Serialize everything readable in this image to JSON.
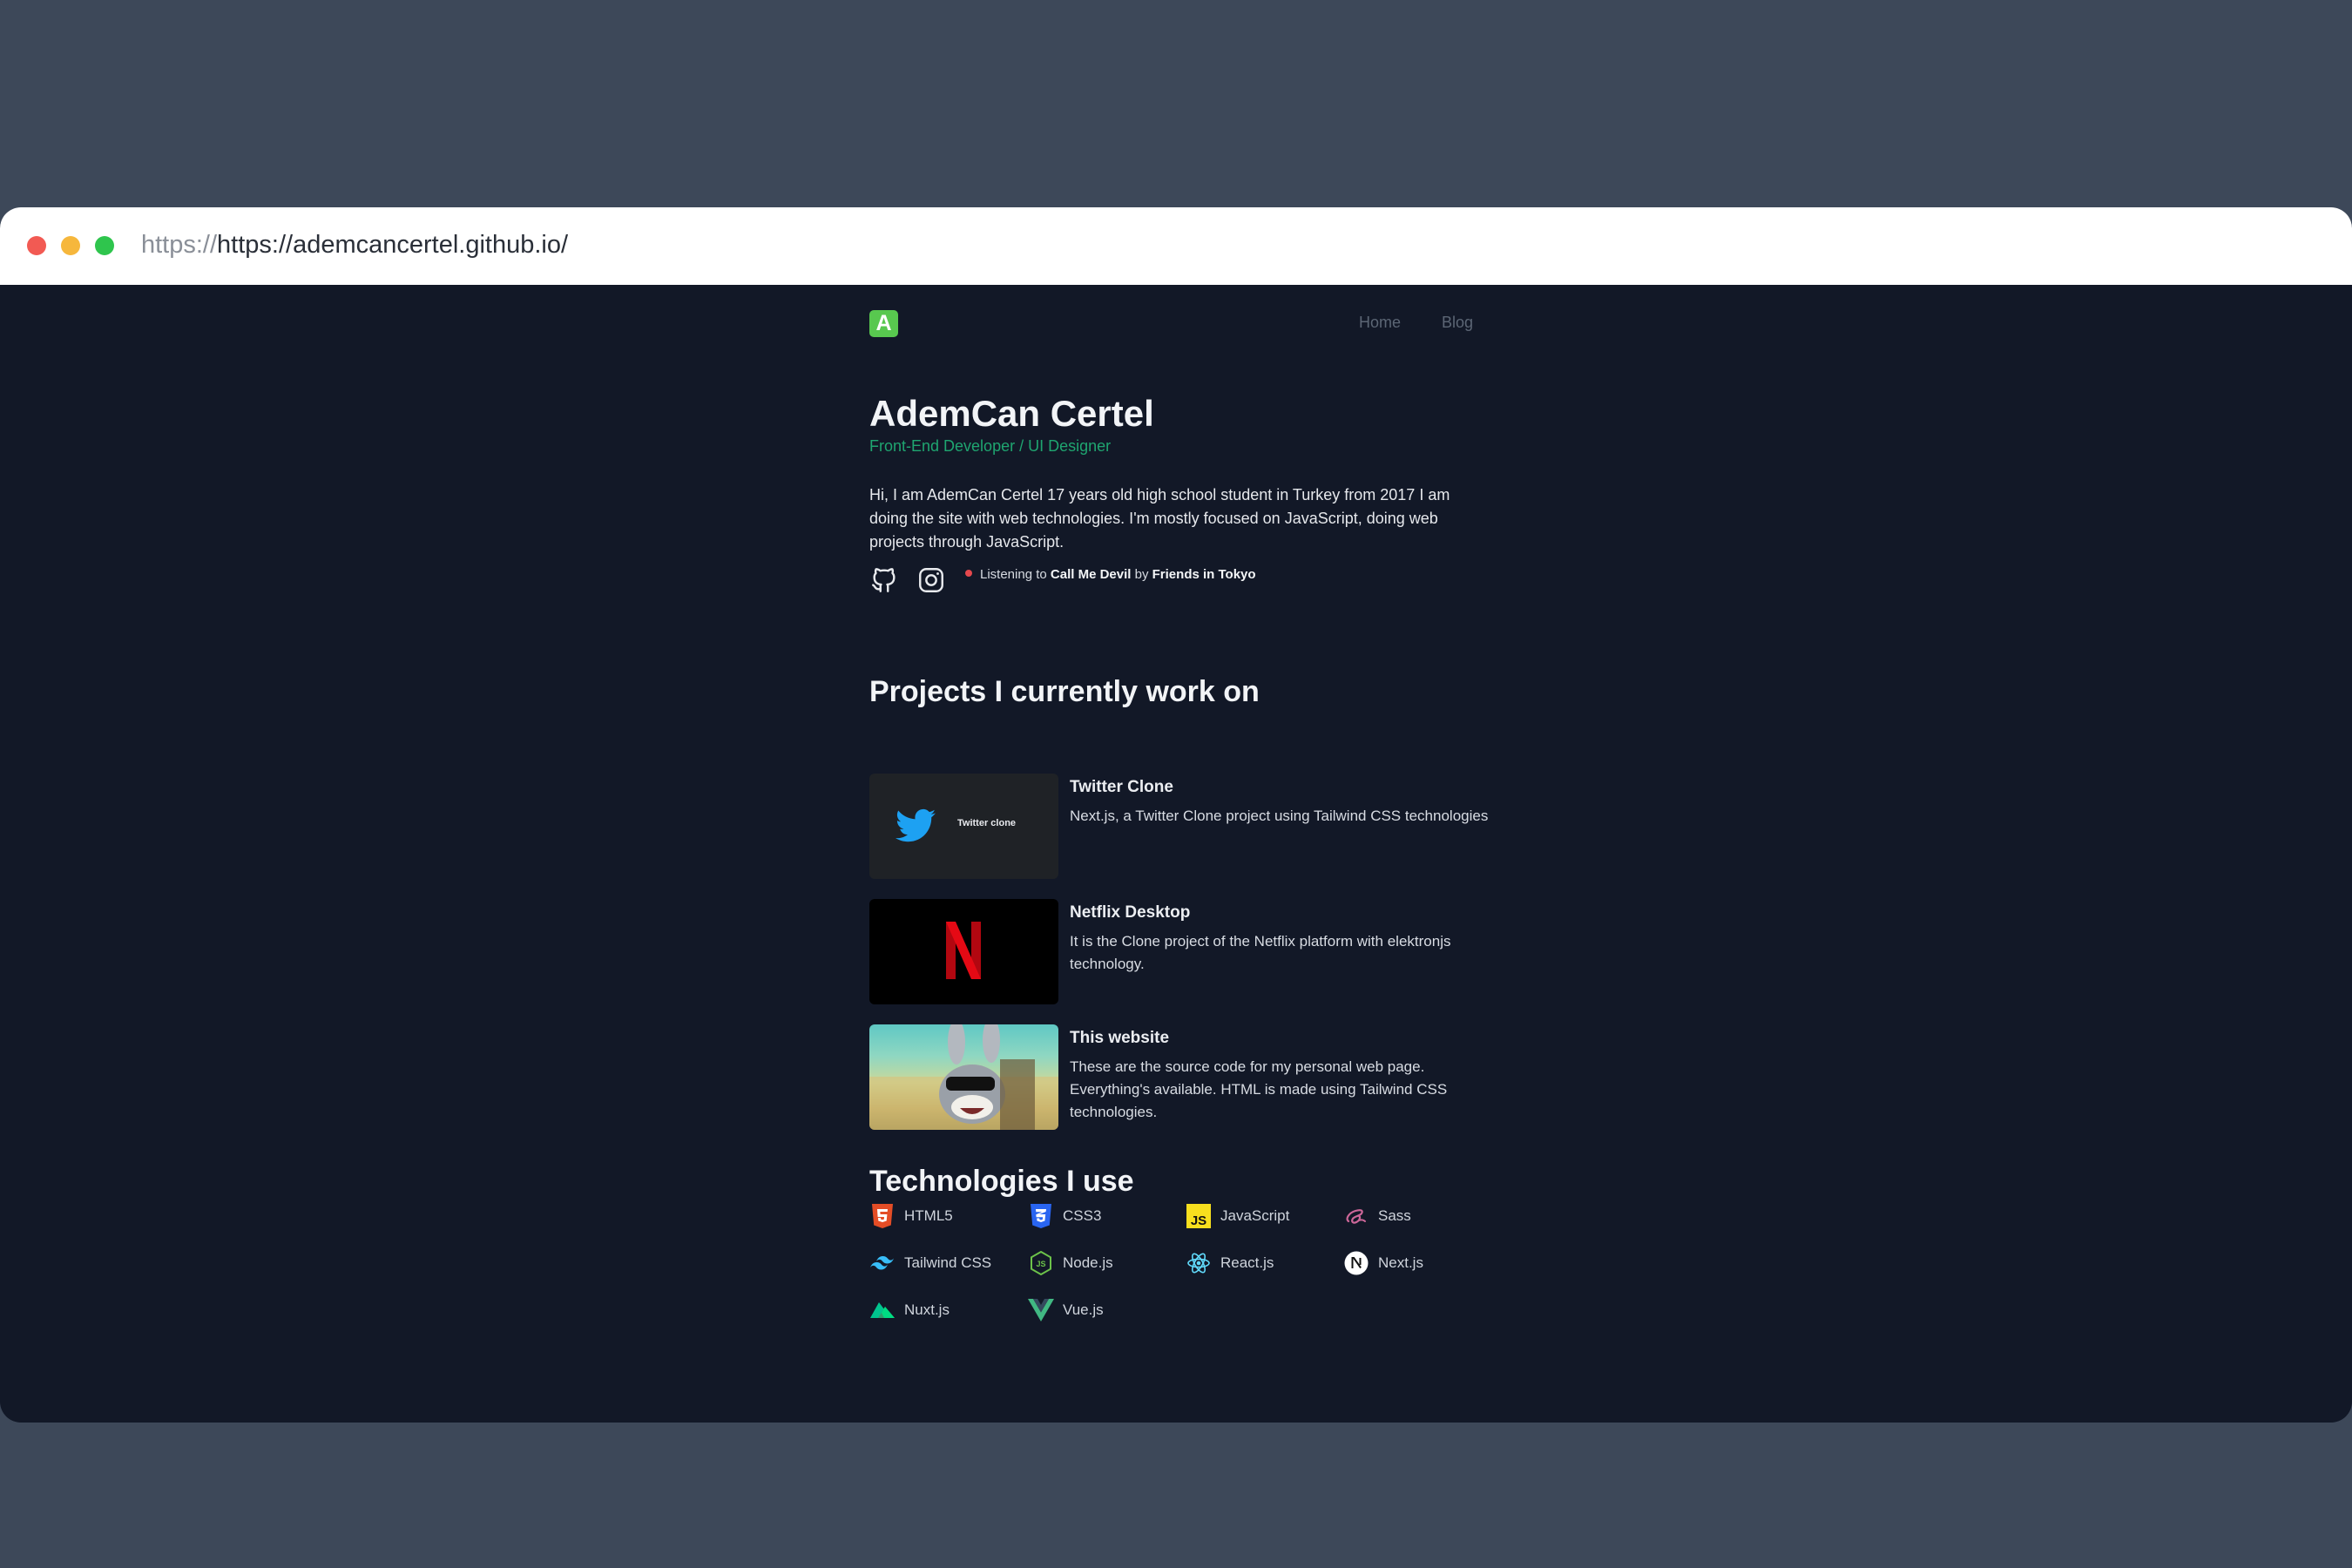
{
  "browser": {
    "url_prefix": "https://",
    "url": "https://ademcancertel.github.io/"
  },
  "header": {
    "logo_letter": "A",
    "nav": [
      "Home",
      "Blog"
    ]
  },
  "profile": {
    "name": "AdemCan Certel",
    "role": "Front-End Developer / UI Designer",
    "bio": "Hi, I am AdemCan Certel 17 years old high school student in Turkey from 2017 I am doing the site with web technologies. I'm mostly focused on JavaScript, doing web projects through JavaScript.",
    "listening_prefix": "Listening to",
    "song": "Call Me Devil",
    "by": "by",
    "artist": "Friends in Tokyo"
  },
  "projects": {
    "heading": "Projects I currently work on",
    "items": [
      {
        "title": "Twitter Clone",
        "description": "Next.js, a Twitter Clone project using Tailwind CSS technologies",
        "thumb_text": "Twitter clone"
      },
      {
        "title": "Netflix Desktop",
        "description": "It is the Clone project of the Netflix platform with elektronjs technology.",
        "thumb_text": "N"
      },
      {
        "title": "This website",
        "description": "These are the source code for my personal web page. Everything's available. HTML is made using Tailwind CSS technologies.",
        "thumb_text": ""
      }
    ]
  },
  "technologies": {
    "heading": "Technologies I use",
    "items": [
      {
        "label": "HTML5",
        "icon": "html5-icon"
      },
      {
        "label": "CSS3",
        "icon": "css3-icon"
      },
      {
        "label": "JavaScript",
        "icon": "javascript-icon"
      },
      {
        "label": "Sass",
        "icon": "sass-icon"
      },
      {
        "label": "Tailwind CSS",
        "icon": "tailwind-icon"
      },
      {
        "label": "Node.js",
        "icon": "nodejs-icon"
      },
      {
        "label": "React.js",
        "icon": "react-icon"
      },
      {
        "label": "Next.js",
        "icon": "nextjs-icon"
      },
      {
        "label": "Nuxt.js",
        "icon": "nuxtjs-icon"
      },
      {
        "label": "Vue.js",
        "icon": "vuejs-icon"
      }
    ]
  },
  "colors": {
    "page_bg": "#3d4859",
    "site_bg": "#121827",
    "accent_green": "#1fa570",
    "logo_green": "#58c84f"
  }
}
